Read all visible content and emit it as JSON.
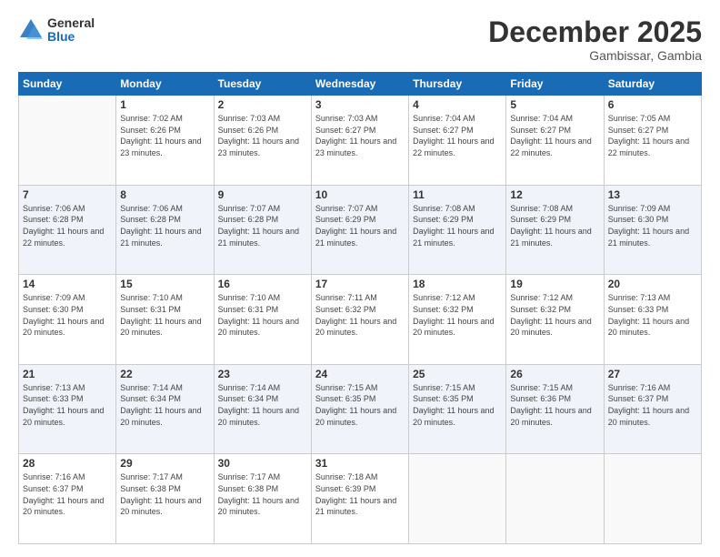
{
  "header": {
    "logo_general": "General",
    "logo_blue": "Blue",
    "month_title": "December 2025",
    "location": "Gambissar, Gambia"
  },
  "weekdays": [
    "Sunday",
    "Monday",
    "Tuesday",
    "Wednesday",
    "Thursday",
    "Friday",
    "Saturday"
  ],
  "weeks": [
    [
      {
        "day": "",
        "sunrise": "",
        "sunset": "",
        "daylight": ""
      },
      {
        "day": "1",
        "sunrise": "Sunrise: 7:02 AM",
        "sunset": "Sunset: 6:26 PM",
        "daylight": "Daylight: 11 hours and 23 minutes."
      },
      {
        "day": "2",
        "sunrise": "Sunrise: 7:03 AM",
        "sunset": "Sunset: 6:26 PM",
        "daylight": "Daylight: 11 hours and 23 minutes."
      },
      {
        "day": "3",
        "sunrise": "Sunrise: 7:03 AM",
        "sunset": "Sunset: 6:27 PM",
        "daylight": "Daylight: 11 hours and 23 minutes."
      },
      {
        "day": "4",
        "sunrise": "Sunrise: 7:04 AM",
        "sunset": "Sunset: 6:27 PM",
        "daylight": "Daylight: 11 hours and 22 minutes."
      },
      {
        "day": "5",
        "sunrise": "Sunrise: 7:04 AM",
        "sunset": "Sunset: 6:27 PM",
        "daylight": "Daylight: 11 hours and 22 minutes."
      },
      {
        "day": "6",
        "sunrise": "Sunrise: 7:05 AM",
        "sunset": "Sunset: 6:27 PM",
        "daylight": "Daylight: 11 hours and 22 minutes."
      }
    ],
    [
      {
        "day": "7",
        "sunrise": "Sunrise: 7:06 AM",
        "sunset": "Sunset: 6:28 PM",
        "daylight": "Daylight: 11 hours and 22 minutes."
      },
      {
        "day": "8",
        "sunrise": "Sunrise: 7:06 AM",
        "sunset": "Sunset: 6:28 PM",
        "daylight": "Daylight: 11 hours and 21 minutes."
      },
      {
        "day": "9",
        "sunrise": "Sunrise: 7:07 AM",
        "sunset": "Sunset: 6:28 PM",
        "daylight": "Daylight: 11 hours and 21 minutes."
      },
      {
        "day": "10",
        "sunrise": "Sunrise: 7:07 AM",
        "sunset": "Sunset: 6:29 PM",
        "daylight": "Daylight: 11 hours and 21 minutes."
      },
      {
        "day": "11",
        "sunrise": "Sunrise: 7:08 AM",
        "sunset": "Sunset: 6:29 PM",
        "daylight": "Daylight: 11 hours and 21 minutes."
      },
      {
        "day": "12",
        "sunrise": "Sunrise: 7:08 AM",
        "sunset": "Sunset: 6:29 PM",
        "daylight": "Daylight: 11 hours and 21 minutes."
      },
      {
        "day": "13",
        "sunrise": "Sunrise: 7:09 AM",
        "sunset": "Sunset: 6:30 PM",
        "daylight": "Daylight: 11 hours and 21 minutes."
      }
    ],
    [
      {
        "day": "14",
        "sunrise": "Sunrise: 7:09 AM",
        "sunset": "Sunset: 6:30 PM",
        "daylight": "Daylight: 11 hours and 20 minutes."
      },
      {
        "day": "15",
        "sunrise": "Sunrise: 7:10 AM",
        "sunset": "Sunset: 6:31 PM",
        "daylight": "Daylight: 11 hours and 20 minutes."
      },
      {
        "day": "16",
        "sunrise": "Sunrise: 7:10 AM",
        "sunset": "Sunset: 6:31 PM",
        "daylight": "Daylight: 11 hours and 20 minutes."
      },
      {
        "day": "17",
        "sunrise": "Sunrise: 7:11 AM",
        "sunset": "Sunset: 6:32 PM",
        "daylight": "Daylight: 11 hours and 20 minutes."
      },
      {
        "day": "18",
        "sunrise": "Sunrise: 7:12 AM",
        "sunset": "Sunset: 6:32 PM",
        "daylight": "Daylight: 11 hours and 20 minutes."
      },
      {
        "day": "19",
        "sunrise": "Sunrise: 7:12 AM",
        "sunset": "Sunset: 6:32 PM",
        "daylight": "Daylight: 11 hours and 20 minutes."
      },
      {
        "day": "20",
        "sunrise": "Sunrise: 7:13 AM",
        "sunset": "Sunset: 6:33 PM",
        "daylight": "Daylight: 11 hours and 20 minutes."
      }
    ],
    [
      {
        "day": "21",
        "sunrise": "Sunrise: 7:13 AM",
        "sunset": "Sunset: 6:33 PM",
        "daylight": "Daylight: 11 hours and 20 minutes."
      },
      {
        "day": "22",
        "sunrise": "Sunrise: 7:14 AM",
        "sunset": "Sunset: 6:34 PM",
        "daylight": "Daylight: 11 hours and 20 minutes."
      },
      {
        "day": "23",
        "sunrise": "Sunrise: 7:14 AM",
        "sunset": "Sunset: 6:34 PM",
        "daylight": "Daylight: 11 hours and 20 minutes."
      },
      {
        "day": "24",
        "sunrise": "Sunrise: 7:15 AM",
        "sunset": "Sunset: 6:35 PM",
        "daylight": "Daylight: 11 hours and 20 minutes."
      },
      {
        "day": "25",
        "sunrise": "Sunrise: 7:15 AM",
        "sunset": "Sunset: 6:35 PM",
        "daylight": "Daylight: 11 hours and 20 minutes."
      },
      {
        "day": "26",
        "sunrise": "Sunrise: 7:15 AM",
        "sunset": "Sunset: 6:36 PM",
        "daylight": "Daylight: 11 hours and 20 minutes."
      },
      {
        "day": "27",
        "sunrise": "Sunrise: 7:16 AM",
        "sunset": "Sunset: 6:37 PM",
        "daylight": "Daylight: 11 hours and 20 minutes."
      }
    ],
    [
      {
        "day": "28",
        "sunrise": "Sunrise: 7:16 AM",
        "sunset": "Sunset: 6:37 PM",
        "daylight": "Daylight: 11 hours and 20 minutes."
      },
      {
        "day": "29",
        "sunrise": "Sunrise: 7:17 AM",
        "sunset": "Sunset: 6:38 PM",
        "daylight": "Daylight: 11 hours and 20 minutes."
      },
      {
        "day": "30",
        "sunrise": "Sunrise: 7:17 AM",
        "sunset": "Sunset: 6:38 PM",
        "daylight": "Daylight: 11 hours and 20 minutes."
      },
      {
        "day": "31",
        "sunrise": "Sunrise: 7:18 AM",
        "sunset": "Sunset: 6:39 PM",
        "daylight": "Daylight: 11 hours and 21 minutes."
      },
      {
        "day": "",
        "sunrise": "",
        "sunset": "",
        "daylight": ""
      },
      {
        "day": "",
        "sunrise": "",
        "sunset": "",
        "daylight": ""
      },
      {
        "day": "",
        "sunrise": "",
        "sunset": "",
        "daylight": ""
      }
    ]
  ]
}
